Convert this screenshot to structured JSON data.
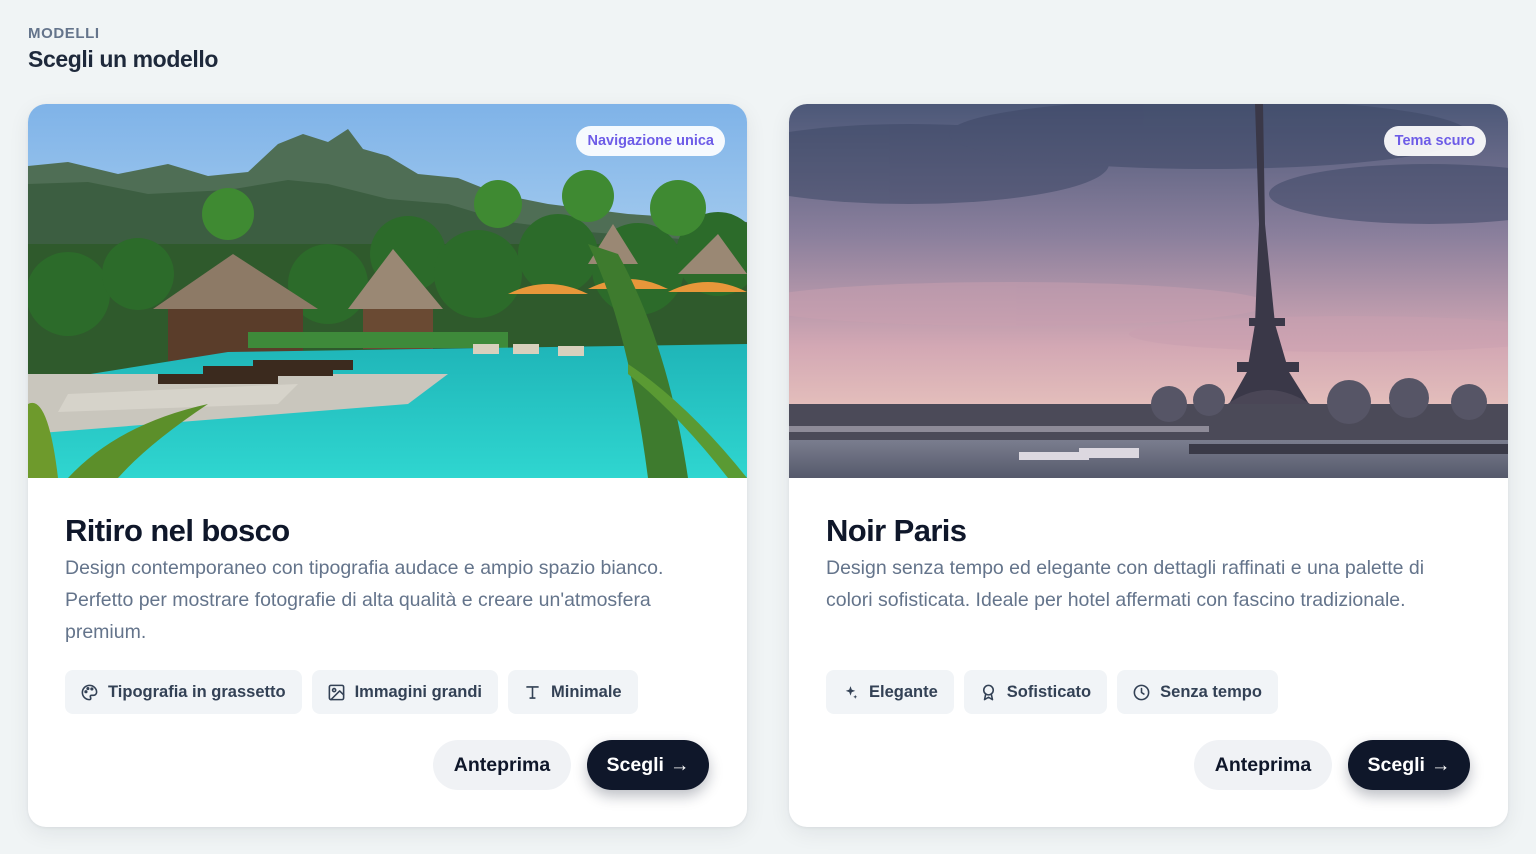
{
  "header": {
    "eyebrow": "MODELLI",
    "title": "Scegli un modello"
  },
  "cards": [
    {
      "badge": "Navigazione unica",
      "image_alt": "Resort tropicale con piscina e palme",
      "title": "Ritiro nel bosco",
      "description": "Design contemporaneo con tipografia audace e ampio spazio bianco. Perfetto per mostrare fotografie di alta qualità e creare un'atmosfera premium.",
      "tags": [
        {
          "icon": "palette-icon",
          "label": "Tipografia in grassetto"
        },
        {
          "icon": "image-icon",
          "label": "Immagini grandi"
        },
        {
          "icon": "type-icon",
          "label": "Minimale"
        }
      ],
      "preview_label": "Anteprima",
      "choose_label": "Scegli",
      "choose_arrow": "→"
    },
    {
      "badge": "Tema scuro",
      "image_alt": "Torre Eiffel al tramonto sulla Senna",
      "title": "Noir Paris",
      "description": "Design senza tempo ed elegante con dettagli raffinati e una palette di colori sofisticata. Ideale per hotel affermati con fascino tradizionale.",
      "tags": [
        {
          "icon": "sparkle-icon",
          "label": "Elegante"
        },
        {
          "icon": "award-icon",
          "label": "Sofisticato"
        },
        {
          "icon": "clock-icon",
          "label": "Senza tempo"
        }
      ],
      "preview_label": "Anteprima",
      "choose_label": "Scegli",
      "choose_arrow": "→"
    }
  ],
  "colors": {
    "background": "#f0f4f5",
    "badge_text": "#6d5ce7",
    "primary_button": "#0f172a",
    "secondary_button": "#f0f2f5",
    "tag_background": "#f1f4f7"
  }
}
